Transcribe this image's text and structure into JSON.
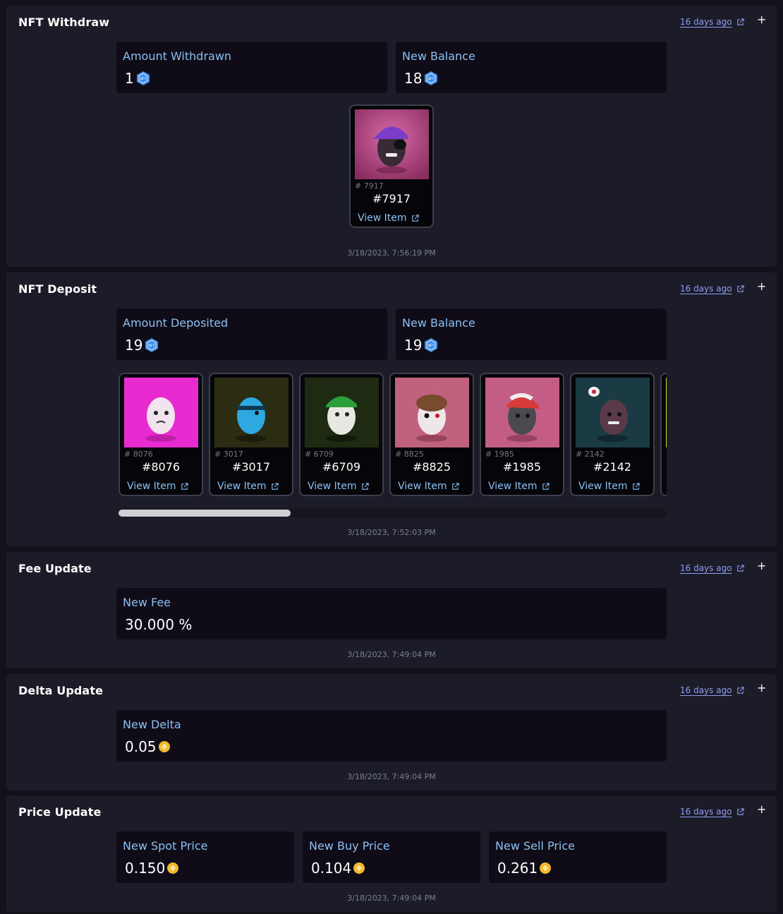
{
  "time_ago": "16 days ago",
  "plus": "+",
  "withdraw": {
    "title": "NFT Withdraw",
    "amount_label": "Amount Withdrawn",
    "amount_value": "1",
    "balance_label": "New Balance",
    "balance_value": "18",
    "nft": {
      "small": "# 7917",
      "name": "#7917",
      "link": "View Item",
      "bg": "#c85a98"
    },
    "date": "3/18/2023, 7:56:19 PM"
  },
  "deposit": {
    "title": "NFT Deposit",
    "amount_label": "Amount Deposited",
    "amount_value": "19",
    "balance_label": "New Balance",
    "balance_value": "19",
    "nfts": [
      {
        "small": "# 8076",
        "name": "#8076",
        "link": "View Item",
        "bg": "#e82bd0"
      },
      {
        "small": "# 3017",
        "name": "#3017",
        "link": "View Item",
        "bg": "#2c2c12"
      },
      {
        "small": "# 6709",
        "name": "#6709",
        "link": "View Item",
        "bg": "#1f2a12"
      },
      {
        "small": "# 8825",
        "name": "#8825",
        "link": "View Item",
        "bg": "#c0627e"
      },
      {
        "small": "# 1985",
        "name": "#1985",
        "link": "View Item",
        "bg": "#c45d86"
      },
      {
        "small": "# 2142",
        "name": "#2142",
        "link": "View Item",
        "bg": "#1a3a44"
      }
    ],
    "date": "3/18/2023, 7:52:03 PM"
  },
  "fee": {
    "title": "Fee Update",
    "label": "New Fee",
    "value": "30.000 %",
    "date": "3/18/2023, 7:49:04 PM"
  },
  "delta": {
    "title": "Delta Update",
    "label": "New Delta",
    "value": "0.05",
    "date": "3/18/2023, 7:49:04 PM"
  },
  "price": {
    "title": "Price Update",
    "spot_label": "New Spot Price",
    "spot_value": "0.150",
    "buy_label": "New Buy Price",
    "buy_value": "0.104",
    "sell_label": "New Sell Price",
    "sell_value": "0.261",
    "date": "3/18/2023, 7:49:04 PM"
  },
  "colors": {
    "accent_label": "#8bc0f2",
    "link": "#8f9cf5",
    "nft_badge": "#3f8ee8",
    "coin": "#f3ba2f"
  },
  "icons": {
    "nft_badge": "nft-hex-icon",
    "coin": "bnb-coin-icon",
    "external": "external-link-icon"
  }
}
